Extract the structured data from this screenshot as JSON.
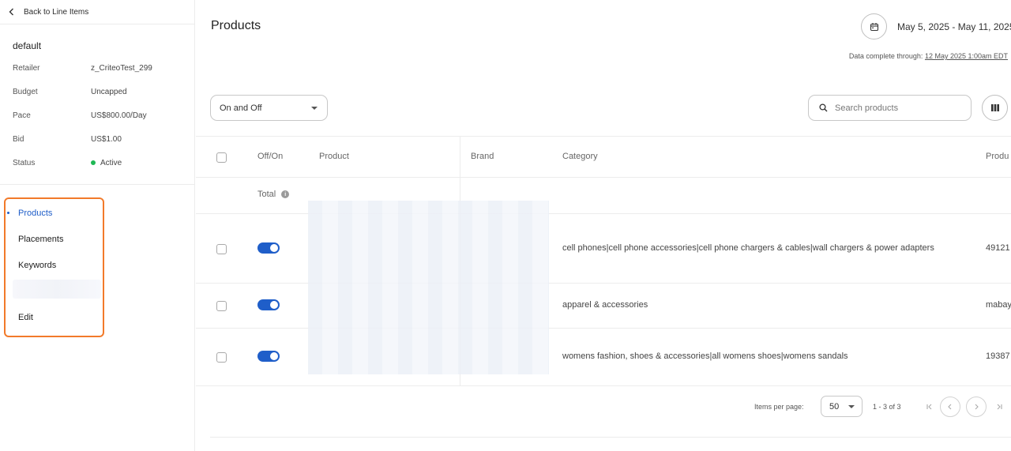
{
  "sidebar": {
    "back_label": "Back to Line Items",
    "line_item_name": "default",
    "meta": [
      {
        "key": "Retailer",
        "value": "z_CriteoTest_299"
      },
      {
        "key": "Budget",
        "value": "Uncapped"
      },
      {
        "key": "Pace",
        "value": "US$800.00/Day"
      },
      {
        "key": "Bid",
        "value": "US$1.00"
      },
      {
        "key": "Status",
        "value": "Active"
      }
    ],
    "nav": [
      {
        "label": "Products",
        "active": true
      },
      {
        "label": "Placements",
        "active": false
      },
      {
        "label": "Keywords",
        "active": false
      },
      {
        "label": "Edit",
        "active": false
      }
    ],
    "highlight_color": "#f27a2a"
  },
  "header": {
    "title": "Products",
    "date_range": "May 5, 2025 - May 11, 2025",
    "data_complete_prefix": "Data complete through:",
    "data_complete_link": "12 May 2025 1:00am EDT"
  },
  "filters": {
    "status_value": "On and Off",
    "search_placeholder": "Search products"
  },
  "table": {
    "columns": [
      "Off/On",
      "Product",
      "Brand",
      "Category",
      "Produ"
    ],
    "total_label": "Total",
    "rows": [
      {
        "on": true,
        "category": "cell phones|cell phone accessories|cell phone chargers & cables|wall chargers & power adapters",
        "id": "49121"
      },
      {
        "on": true,
        "category": "apparel & accessories",
        "id": "mabay"
      },
      {
        "on": true,
        "category": "womens fashion, shoes & accessories|all womens shoes|womens sandals",
        "id": "19387"
      }
    ]
  },
  "pagination": {
    "items_per_page_label": "Items per page:",
    "items_per_page_value": "50",
    "range": "1 - 3 of 3"
  },
  "colors": {
    "accent": "#1f5ec9",
    "active_status": "#1fb854"
  }
}
